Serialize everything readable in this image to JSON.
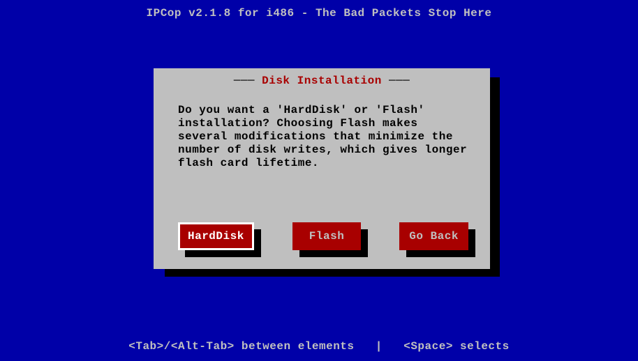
{
  "header": {
    "title": "IPCop v2.1.8 for i486 - The Bad Packets Stop Here"
  },
  "dialog": {
    "title": "Disk Installation",
    "body": "Do you want a 'HardDisk' or 'Flash' installation? Choosing Flash makes several modifications that minimize the number of disk writes, which gives longer flash card lifetime.",
    "buttons": {
      "harddisk": "HardDisk",
      "flash": "Flash",
      "goback": "Go Back"
    },
    "focused_button": "harddisk"
  },
  "footer": {
    "text": "<Tab>/<Alt-Tab> between elements   |   <Space> selects"
  },
  "colors": {
    "background": "#0000a8",
    "dialog_bg": "#bfbfbf",
    "button_bg": "#a80000",
    "text_gray": "#c0c0c0",
    "text_red": "#a80000"
  }
}
